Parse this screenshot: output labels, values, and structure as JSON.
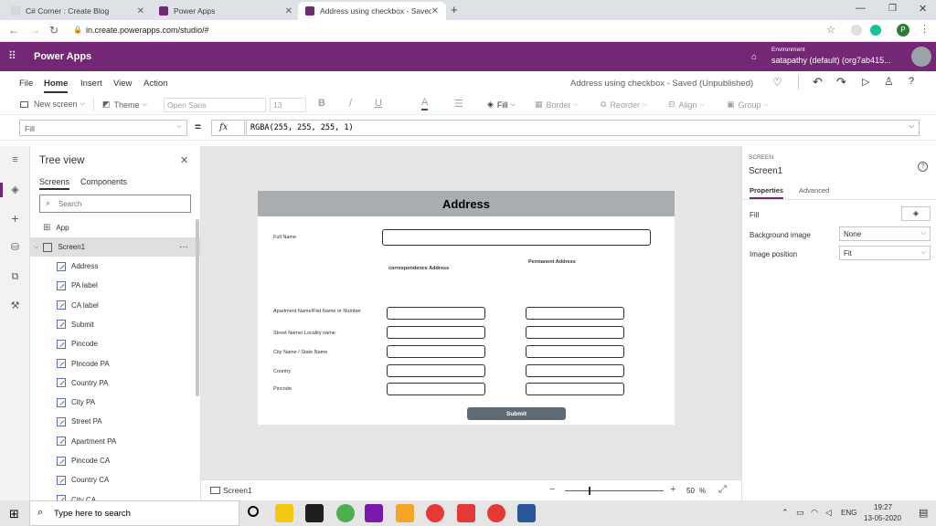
{
  "browser": {
    "tabs": [
      {
        "title": "C# Corner : Create Blog",
        "color": "#9e9e9e"
      },
      {
        "title": "Power Apps",
        "color": "#742774"
      },
      {
        "title": "Address using checkbox - Saved",
        "color": "#742774"
      }
    ],
    "new_tab": "+",
    "url": "in.create.powerapps.com/studio/#",
    "profile_initial": "P"
  },
  "powerapps": {
    "brand": "Power Apps",
    "env_label": "Environment",
    "env_name": "satapathy (default) (org7ab415..."
  },
  "menu": {
    "items": [
      "File",
      "Home",
      "Insert",
      "View",
      "Action"
    ],
    "active": "Home",
    "status": "Address using checkbox - Saved (Unpublished)"
  },
  "toolbar": {
    "new_screen": "New screen",
    "theme": "Theme",
    "font": "Open Sans",
    "font_size": "13",
    "bold": "B",
    "italic": "/",
    "underline": "U",
    "fill": "Fill",
    "border": "Border",
    "reorder": "Reorder",
    "align": "Align",
    "group": "Group"
  },
  "formula": {
    "property": "Fill",
    "equals": "=",
    "fx": "fx",
    "value": "RGBA(255, 255, 255, 1)"
  },
  "tree": {
    "title": "Tree view",
    "tabs": [
      "Screens",
      "Components"
    ],
    "search_placeholder": "Search",
    "app": "App",
    "screen": "Screen1",
    "more": "···",
    "items": [
      "Address",
      "PA label",
      "CA label",
      "Submit",
      "Pincode",
      "PIncode PA",
      "Country PA",
      "City PA",
      "Street PA",
      "Apartment PA",
      "Pincode CA",
      "Country CA",
      "City CA"
    ]
  },
  "form": {
    "title": "Address",
    "full_name": "Full Name",
    "ca_heading": "correspondence Address",
    "pa_heading": "Permanent Address",
    "rows": [
      "Apartment Name/Flat Name or Number",
      "Street Name/ Locality name",
      "City Name / State Name",
      "Country",
      "Pincode"
    ],
    "submit": "Submit"
  },
  "bottom": {
    "screen": "Screen1",
    "minus": "−",
    "plus": "+",
    "zoom": "50",
    "percent": "%"
  },
  "props": {
    "kind": "SCREEN",
    "name": "Screen1",
    "tabs": [
      "Properties",
      "Advanced"
    ],
    "fill_label": "Fill",
    "bg_label": "Background image",
    "bg_value": "None",
    "pos_label": "Image position",
    "pos_value": "Fit"
  },
  "taskbar": {
    "search": "Type here to search",
    "lang": "ENG",
    "time": "19:27",
    "date": "13-05-2020"
  },
  "colors": {
    "accent": "#742774",
    "header_grey": "#a8adb2",
    "submit_bg": "#5f6b75"
  }
}
